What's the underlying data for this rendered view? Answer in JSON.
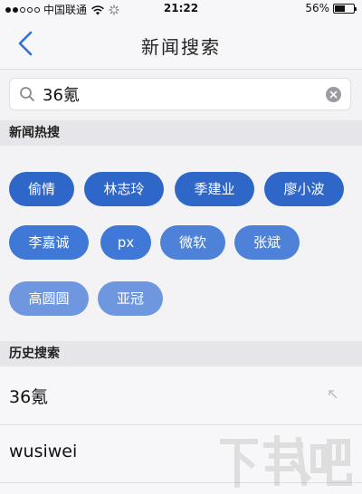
{
  "status_bar": {
    "carrier": "中国联通",
    "time": "21:22",
    "battery": "56%",
    "battery_level": 0.56
  },
  "nav": {
    "title": "新闻搜索"
  },
  "search": {
    "value": "36氪",
    "placeholder": ""
  },
  "hot": {
    "header": "新闻热搜",
    "tags": [
      {
        "label": "偷情",
        "color": "#2f67c9"
      },
      {
        "label": "林志玲",
        "color": "#2f67c9"
      },
      {
        "label": "季建业",
        "color": "#2f67c9"
      },
      {
        "label": "廖小波",
        "color": "#2f67c9"
      },
      {
        "label": "李嘉诚",
        "color": "#3f78d6"
      },
      {
        "label": "px",
        "color": "#3f78d6"
      },
      {
        "label": "微软",
        "color": "#4e82d9"
      },
      {
        "label": "张斌",
        "color": "#4e82d9"
      },
      {
        "label": "高圆圆",
        "color": "#6f97e0"
      },
      {
        "label": "亚冠",
        "color": "#6f97e0"
      }
    ]
  },
  "history": {
    "header": "历史搜索",
    "items": [
      {
        "text": "36氪"
      },
      {
        "text": "wusiwei"
      }
    ]
  },
  "watermark": {
    "text": "下载吧"
  },
  "icons": {
    "back": "chevron-left-icon",
    "search": "search-icon",
    "clear": "clear-icon",
    "wifi": "wifi-icon",
    "loading": "activity-spinner-icon",
    "fill": "arrow-up-left-icon"
  },
  "colors": {
    "accent": "#2f67c9",
    "back_arrow": "#2f6fd6"
  }
}
